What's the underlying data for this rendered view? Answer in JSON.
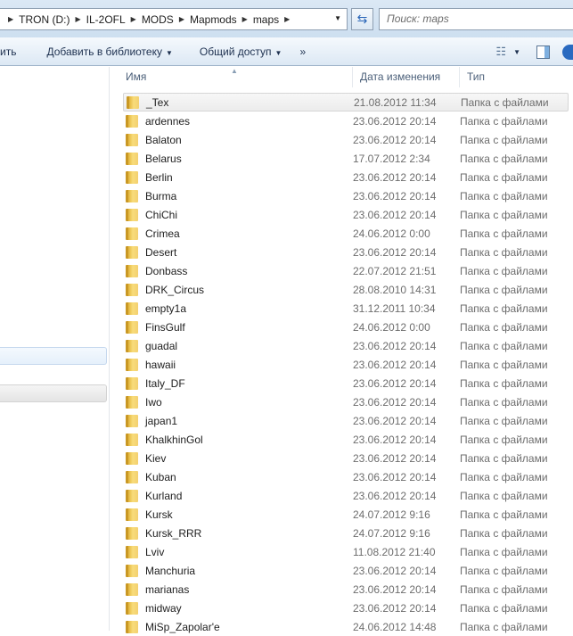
{
  "address": {
    "crumbs": [
      "TRON (D:)",
      "IL-2OFL",
      "MODS",
      "Mapmods",
      "maps"
    ]
  },
  "search": {
    "placeholder": "Поиск: maps"
  },
  "toolbar": {
    "partial": "ить",
    "add_library": "Добавить в библиотеку",
    "share": "Общий доступ",
    "more": "»"
  },
  "columns": {
    "name": "Имя",
    "date": "Дата изменения",
    "type": "Тип"
  },
  "files": [
    {
      "name": "_Tex",
      "date": "21.08.2012 11:34",
      "type": "Папка с файлами"
    },
    {
      "name": "ardennes",
      "date": "23.06.2012 20:14",
      "type": "Папка с файлами"
    },
    {
      "name": "Balaton",
      "date": "23.06.2012 20:14",
      "type": "Папка с файлами"
    },
    {
      "name": "Belarus",
      "date": "17.07.2012 2:34",
      "type": "Папка с файлами"
    },
    {
      "name": "Berlin",
      "date": "23.06.2012 20:14",
      "type": "Папка с файлами"
    },
    {
      "name": "Burma",
      "date": "23.06.2012 20:14",
      "type": "Папка с файлами"
    },
    {
      "name": "ChiChi",
      "date": "23.06.2012 20:14",
      "type": "Папка с файлами"
    },
    {
      "name": "Crimea",
      "date": "24.06.2012 0:00",
      "type": "Папка с файлами"
    },
    {
      "name": "Desert",
      "date": "23.06.2012 20:14",
      "type": "Папка с файлами"
    },
    {
      "name": "Donbass",
      "date": "22.07.2012 21:51",
      "type": "Папка с файлами"
    },
    {
      "name": "DRK_Circus",
      "date": "28.08.2010 14:31",
      "type": "Папка с файлами"
    },
    {
      "name": "empty1a",
      "date": "31.12.2011 10:34",
      "type": "Папка с файлами"
    },
    {
      "name": "FinsGulf",
      "date": "24.06.2012 0:00",
      "type": "Папка с файлами"
    },
    {
      "name": "guadal",
      "date": "23.06.2012 20:14",
      "type": "Папка с файлами"
    },
    {
      "name": "hawaii",
      "date": "23.06.2012 20:14",
      "type": "Папка с файлами"
    },
    {
      "name": "Italy_DF",
      "date": "23.06.2012 20:14",
      "type": "Папка с файлами"
    },
    {
      "name": "Iwo",
      "date": "23.06.2012 20:14",
      "type": "Папка с файлами"
    },
    {
      "name": "japan1",
      "date": "23.06.2012 20:14",
      "type": "Папка с файлами"
    },
    {
      "name": "KhalkhinGol",
      "date": "23.06.2012 20:14",
      "type": "Папка с файлами"
    },
    {
      "name": "Kiev",
      "date": "23.06.2012 20:14",
      "type": "Папка с файлами"
    },
    {
      "name": "Kuban",
      "date": "23.06.2012 20:14",
      "type": "Папка с файлами"
    },
    {
      "name": "Kurland",
      "date": "23.06.2012 20:14",
      "type": "Папка с файлами"
    },
    {
      "name": "Kursk",
      "date": "24.07.2012 9:16",
      "type": "Папка с файлами"
    },
    {
      "name": "Kursk_RRR",
      "date": "24.07.2012 9:16",
      "type": "Папка с файлами"
    },
    {
      "name": "Lviv",
      "date": "11.08.2012 21:40",
      "type": "Папка с файлами"
    },
    {
      "name": "Manchuria",
      "date": "23.06.2012 20:14",
      "type": "Папка с файлами"
    },
    {
      "name": "marianas",
      "date": "23.06.2012 20:14",
      "type": "Папка с файлами"
    },
    {
      "name": "midway",
      "date": "23.06.2012 20:14",
      "type": "Папка с файлами"
    },
    {
      "name": "MiSp_Zapolar'e",
      "date": "24.06.2012 14:48",
      "type": "Папка с файлами"
    }
  ]
}
